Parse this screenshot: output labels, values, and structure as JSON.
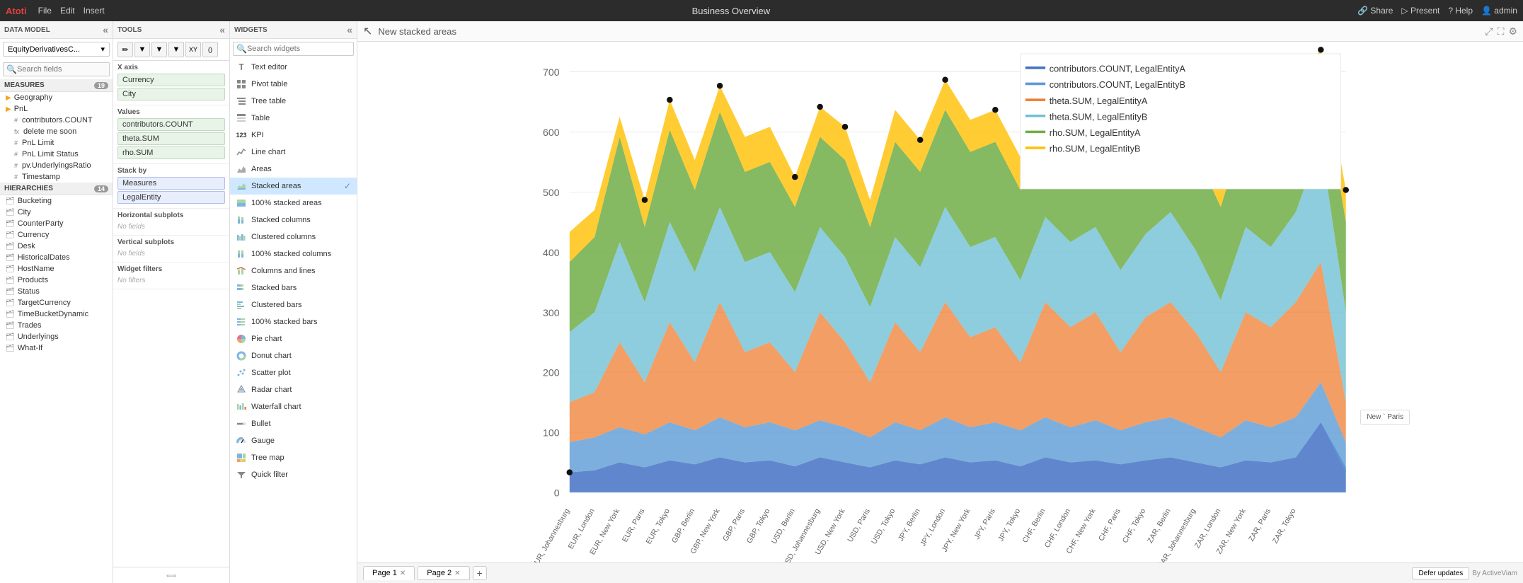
{
  "app": {
    "brand": "Atoti",
    "menu": [
      "File",
      "Edit",
      "Insert"
    ],
    "title": "Business Overview",
    "topRight": [
      "Share",
      "Present",
      "? Help",
      "admin"
    ]
  },
  "dataModel": {
    "header": "DATA MODEL",
    "model": "EquityDerivativesC...",
    "searchPlaceholder": "Search fields",
    "measures": {
      "label": "MEASURES",
      "count": 19,
      "items": [
        {
          "type": "folder",
          "name": "Geography"
        },
        {
          "type": "folder",
          "name": "PnL"
        },
        {
          "type": "hash",
          "name": "contributors.COUNT"
        },
        {
          "type": "fx",
          "name": "delete me soon"
        },
        {
          "type": "hash",
          "name": "PnL Limit"
        },
        {
          "type": "hash",
          "name": "PnL Limit Status"
        },
        {
          "type": "hash",
          "name": "pv.UnderlyingsRatio"
        },
        {
          "type": "hash",
          "name": "Timestamp"
        }
      ]
    },
    "hierarchies": {
      "label": "HIERARCHIES",
      "count": 14,
      "items": [
        {
          "type": "folder",
          "name": "Bucketing"
        },
        {
          "type": "folder",
          "name": "City"
        },
        {
          "type": "folder",
          "name": "CounterParty"
        },
        {
          "type": "folder",
          "name": "Currency"
        },
        {
          "type": "folder",
          "name": "Desk"
        },
        {
          "type": "folder",
          "name": "HistoricalDates"
        },
        {
          "type": "folder",
          "name": "HostName"
        },
        {
          "type": "folder",
          "name": "Products"
        },
        {
          "type": "folder",
          "name": "Status"
        },
        {
          "type": "folder",
          "name": "TargetCurrency"
        },
        {
          "type": "folder",
          "name": "TimeBucketDynamic"
        },
        {
          "type": "folder",
          "name": "Trades"
        },
        {
          "type": "folder",
          "name": "Underlyings"
        },
        {
          "type": "folder",
          "name": "What-If"
        }
      ]
    }
  },
  "tools": {
    "header": "TOOLS",
    "xAxis": {
      "label": "X axis",
      "value": "Currency",
      "value2": "City"
    },
    "values": {
      "label": "Values",
      "items": [
        "contributors.COUNT",
        "theta.SUM",
        "rho.SUM"
      ]
    },
    "stackBy": {
      "label": "Stack by",
      "items": [
        "Measures",
        "LegalEntity"
      ]
    },
    "horizontalSubplots": {
      "label": "Horizontal subplots",
      "noFields": "No fields"
    },
    "verticalSubplots": {
      "label": "Vertical subplots",
      "noFields": "No fields"
    },
    "widgetFilters": {
      "label": "Widget filters",
      "noFilters": "No filters"
    }
  },
  "widgets": {
    "header": "WIDGETS",
    "searchPlaceholder": "Search widgets",
    "items": [
      {
        "id": "text-editor",
        "label": "Text editor",
        "icon": "T"
      },
      {
        "id": "pivot-table",
        "label": "Pivot table",
        "icon": "⊞"
      },
      {
        "id": "tree-table",
        "label": "Tree table",
        "icon": "⊟"
      },
      {
        "id": "table",
        "label": "Table",
        "icon": "☰"
      },
      {
        "id": "kpi",
        "label": "KPI",
        "icon": "123"
      },
      {
        "id": "line-chart",
        "label": "Line chart",
        "icon": "📈"
      },
      {
        "id": "areas",
        "label": "Areas",
        "icon": "▲"
      },
      {
        "id": "stacked-areas",
        "label": "Stacked areas",
        "icon": "▲",
        "selected": true
      },
      {
        "id": "100-stacked-areas",
        "label": "100% stacked areas",
        "icon": "▲"
      },
      {
        "id": "stacked-columns",
        "label": "Stacked columns",
        "icon": "▐"
      },
      {
        "id": "clustered-columns",
        "label": "Clustered columns",
        "icon": "▐"
      },
      {
        "id": "100-stacked-columns",
        "label": "100% stacked columns",
        "icon": "▐"
      },
      {
        "id": "columns-and-lines",
        "label": "Columns and lines",
        "icon": "▐"
      },
      {
        "id": "stacked-bars",
        "label": "Stacked bars",
        "icon": "▬"
      },
      {
        "id": "clustered-bars",
        "label": "Clustered bars",
        "icon": "▬"
      },
      {
        "id": "100-stacked-bars",
        "label": "100% stacked bars",
        "icon": "▬"
      },
      {
        "id": "pie-chart",
        "label": "Pie chart",
        "icon": "◔"
      },
      {
        "id": "donut-chart",
        "label": "Donut chart",
        "icon": "◎"
      },
      {
        "id": "scatter-plot",
        "label": "Scatter plot",
        "icon": "⁚"
      },
      {
        "id": "radar-chart",
        "label": "Radar chart",
        "icon": "⬡"
      },
      {
        "id": "waterfall-chart",
        "label": "Waterfall chart",
        "icon": "↓"
      },
      {
        "id": "bullet",
        "label": "Bullet",
        "icon": "▶"
      },
      {
        "id": "gauge",
        "label": "Gauge",
        "icon": "◑"
      },
      {
        "id": "tree-map",
        "label": "Tree map",
        "icon": "▦"
      },
      {
        "id": "quick-filter",
        "label": "Quick filter",
        "icon": "▼"
      }
    ]
  },
  "chart": {
    "newTitle": "New stacked areas",
    "yLabels": [
      "700",
      "600",
      "500",
      "400",
      "300",
      "200",
      "100",
      "0"
    ],
    "xLabels": [
      "EUR, EUR, Johannesburg",
      "EUR, London",
      "EUR, New York",
      "EUR, Paris",
      "EUR, Tokyo",
      "GBP, Berlin",
      "GBP, New York",
      "GBP, Paris",
      "GBP, Tokyo",
      "USD, Berlin",
      "USD, Johannesburg",
      "USD, New York",
      "USD, Paris",
      "USD, Tokyo",
      "JPY, Berlin",
      "JPY, London",
      "JPY, New York",
      "JPY, Paris",
      "JPY, Tokyo",
      "CHF, Berlin",
      "CHF, London",
      "CHF, New York",
      "CHF, Paris",
      "CHF, Tokyo",
      "ZAR, Berlin",
      "ZAR, Johannesburg",
      "ZAR, London",
      "ZAR, New York",
      "ZAR, Paris",
      "ZAR, Tokyo"
    ],
    "legend": [
      {
        "label": "contributors.COUNT, LegalEntityA",
        "color": "#4472c4"
      },
      {
        "label": "contributors.COUNT, LegalEntityB",
        "color": "#5b9bd5"
      },
      {
        "label": "theta.SUM, LegalEntityA",
        "color": "#ed7d31"
      },
      {
        "label": "theta.SUM, LegalEntityB",
        "color": "#70c0d4"
      },
      {
        "label": "rho.SUM, LegalEntityA",
        "color": "#70ad47"
      },
      {
        "label": "rho.SUM, LegalEntityB",
        "color": "#ffc000"
      }
    ]
  },
  "pages": {
    "tabs": [
      {
        "label": "Page 1",
        "closeable": true,
        "active": true
      },
      {
        "label": "Page 2",
        "closeable": true,
        "active": false
      }
    ],
    "addLabel": "+",
    "deferLabel": "Defer updates",
    "activeViLabel": "By ActiveViam"
  },
  "toolbar": {
    "icons": [
      "✏",
      "▼",
      "▼",
      "▼",
      "XY",
      "()"
    ]
  }
}
